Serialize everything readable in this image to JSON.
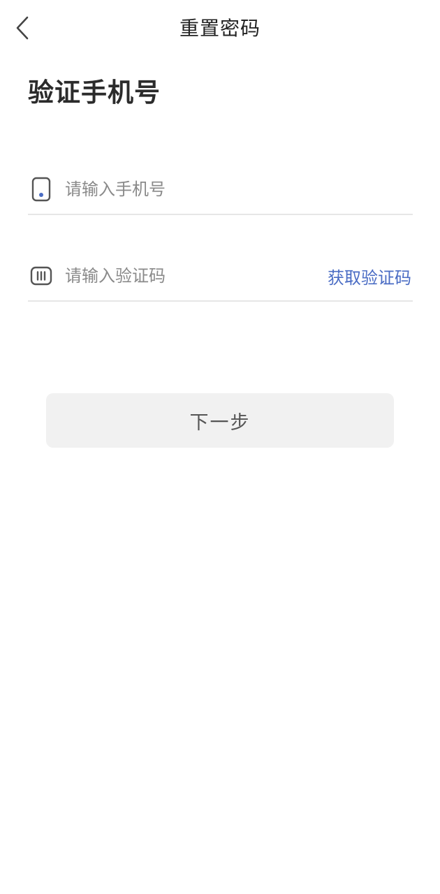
{
  "nav": {
    "back_icon": "chevron-left-icon",
    "title": "重置密码"
  },
  "heading": "验证手机号",
  "phone_field": {
    "icon": "phone-icon",
    "placeholder": "请输入手机号",
    "value": ""
  },
  "code_field": {
    "icon": "verification-code-icon",
    "placeholder": "请输入验证码",
    "value": "",
    "get_code_label": "获取验证码"
  },
  "next_button": {
    "label": "下一步"
  },
  "colors": {
    "accent": "#4a6cc4",
    "button_bg": "#f1f1f1",
    "divider": "#e6e6e6"
  }
}
